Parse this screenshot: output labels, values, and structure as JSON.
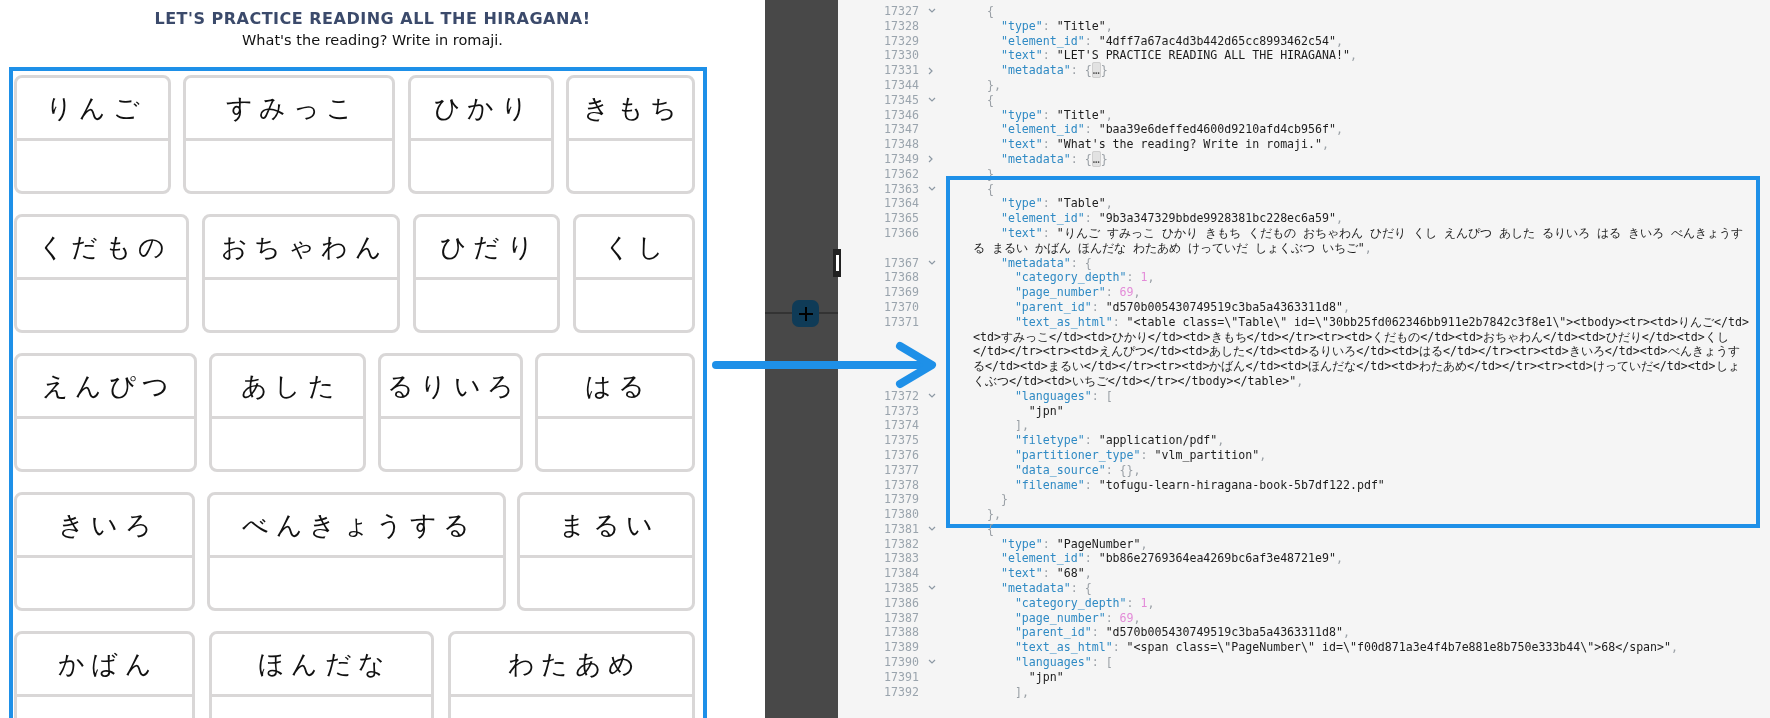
{
  "document": {
    "title": "LET'S PRACTICE READING ALL THE HIRAGANA!",
    "subtitle": "What's the reading? Write in romaji.",
    "table": {
      "highlighted": true,
      "rows": [
        {
          "words": [
            "りんご",
            "すみっこ",
            "ひかり",
            "きもち"
          ]
        },
        {
          "words": [
            "くだもの",
            "おちゃわん",
            "ひだり",
            "くし"
          ]
        },
        {
          "words": [
            "えんぴつ",
            "あした",
            "るりいろ",
            "はる"
          ]
        },
        {
          "words": [
            "きいろ",
            "べんきょうする",
            "まるい"
          ]
        },
        {
          "words": [
            "かばん",
            "ほんだな",
            "わたあめ"
          ]
        }
      ]
    }
  },
  "code": {
    "sections": [
      {
        "highlighted": false,
        "lines": [
          {
            "number": "17327",
            "expanded": true,
            "text": "  {"
          },
          {
            "number": "17328",
            "text": "    \"type\": \"Title\","
          },
          {
            "number": "17329",
            "text": "    \"element_id\": \"4dff7a67ac4d3b442d65cc8993462c54\","
          },
          {
            "number": "17330",
            "text": "    \"text\": \"LET'S PRACTICE READING ALL THE HIRAGANA!\","
          },
          {
            "number": "17331",
            "expanded": false,
            "text": "    \"metadata\": {…}"
          },
          {
            "number": "17344",
            "text": "  },"
          },
          {
            "number": "17345",
            "expanded": true,
            "text": "  {"
          },
          {
            "number": "17346",
            "text": "    \"type\": \"Title\","
          },
          {
            "number": "17347",
            "text": "    \"element_id\": \"baa39e6deffed4600d9210afd4cb956f\","
          },
          {
            "number": "17348",
            "text": "    \"text\": \"What's the reading? Write in romaji.\","
          },
          {
            "number": "17349",
            "expanded": false,
            "text": "    \"metadata\": {…}"
          },
          {
            "number": "17362",
            "text": "  },"
          }
        ]
      },
      {
        "highlighted": true,
        "lines": [
          {
            "number": "17363",
            "expanded": true,
            "text": "  {"
          },
          {
            "number": "17364",
            "text": "    \"type\": \"Table\","
          },
          {
            "number": "17365",
            "text": "    \"element_id\": \"9b3a347329bbde9928381bc228ec6a59\","
          },
          {
            "number": "17366",
            "text": "    \"text\": \"りんご すみっこ ひかり きもち くだもの おちゃわん ひだり くし えんぴつ あした るりいろ はる きいろ べんきょうする まるい かばん ほんだな わたあめ けっていだ しょくぶつ いちご\","
          },
          {
            "number": "17367",
            "expanded": true,
            "text": "    \"metadata\": {"
          },
          {
            "number": "17368",
            "text": "      \"category_depth\": 1,"
          },
          {
            "number": "17369",
            "text": "      \"page_number\": 69,"
          },
          {
            "number": "17370",
            "text": "      \"parent_id\": \"d570b005430749519c3ba5a4363311d8\","
          },
          {
            "number": "17371",
            "text": "      \"text_as_html\": \"<table class=\\\"Table\\\" id=\\\"30bb25fd062346bb911e2b7842c3f8e1\\\"><tbody><tr><td>りんご</td><td>すみっこ</td><td>ひかり</td><td>きもち</td></tr><tr><td>くだもの</td><td>おちゃわん</td><td>ひだり</td><td>くし</td></tr><tr><td>えんぴつ</td><td>あした</td><td>るりいろ</td><td>はる</td></tr><tr><td>きいろ</td><td>べんきょうする</td><td>まるい</td></tr><tr><td>かばん</td><td>ほんだな</td><td>わたあめ</td></tr><tr><td>けっていだ</td><td>しょくぶつ</td><td>いちご</td></tr></tbody></table>\","
          },
          {
            "number": "17372",
            "expanded": true,
            "text": "      \"languages\": ["
          },
          {
            "number": "17373",
            "text": "        \"jpn\""
          },
          {
            "number": "17374",
            "text": "      ],"
          },
          {
            "number": "17375",
            "text": "      \"filetype\": \"application/pdf\","
          },
          {
            "number": "17376",
            "text": "      \"partitioner_type\": \"vlm_partition\","
          },
          {
            "number": "17377",
            "text": "      \"data_source\": {},"
          },
          {
            "number": "17378",
            "text": "      \"filename\": \"tofugu-learn-hiragana-book-5b7df122.pdf\""
          },
          {
            "number": "17379",
            "text": "    }"
          },
          {
            "number": "17380",
            "text": "  },"
          }
        ]
      },
      {
        "highlighted": false,
        "lines": [
          {
            "number": "17381",
            "expanded": true,
            "text": "  {"
          },
          {
            "number": "17382",
            "text": "    \"type\": \"PageNumber\","
          },
          {
            "number": "17383",
            "text": "    \"element_id\": \"bb86e2769364ea4269bc6af3e48721e9\","
          },
          {
            "number": "17384",
            "text": "    \"text\": \"68\","
          },
          {
            "number": "17385",
            "expanded": true,
            "text": "    \"metadata\": {"
          },
          {
            "number": "17386",
            "text": "      \"category_depth\": 1,"
          },
          {
            "number": "17387",
            "text": "      \"page_number\": 69,"
          },
          {
            "number": "17388",
            "text": "      \"parent_id\": \"d570b005430749519c3ba5a4363311d8\","
          },
          {
            "number": "17389",
            "text": "      \"text_as_html\": \"<span class=\\\"PageNumber\\\" id=\\\"f00d871a3e4f4b7e881e8b750e333b44\\\">68</span>\","
          },
          {
            "number": "17390",
            "expanded": true,
            "text": "      \"languages\": ["
          },
          {
            "number": "17391",
            "text": "        \"jpn\""
          },
          {
            "number": "17392",
            "text": "      ],"
          }
        ]
      }
    ]
  }
}
